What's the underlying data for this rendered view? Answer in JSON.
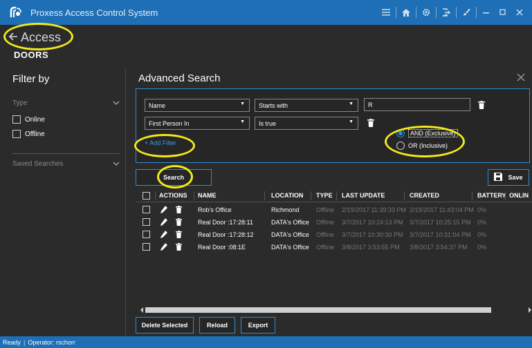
{
  "app": {
    "title": "Proxess Access Control System",
    "accent": "#1e6fb5",
    "highlight": "#f2ea1a"
  },
  "titlebar_icons": [
    "menu-icon",
    "home-icon",
    "gear-icon",
    "logout-icon",
    "brush-icon",
    "minimize-icon",
    "maximize-icon",
    "close-icon"
  ],
  "header": {
    "back_label": "Access",
    "section_label": "DOORS"
  },
  "sidebar": {
    "title": "Filter by",
    "type_label": "Type",
    "options": [
      "Online",
      "Offline"
    ],
    "saved_label": "Saved Searches"
  },
  "advanced": {
    "title": "Advanced Search",
    "filters": [
      {
        "field": "Name",
        "operator": "Starts with",
        "value": "R"
      },
      {
        "field": "First Person In",
        "operator": "Is true",
        "value": ""
      }
    ],
    "add_filter": "+ Add Filter",
    "logic_and": "AND (Exclusive)",
    "logic_or": "OR (Inclusive)",
    "search_label": "Search",
    "save_label": "Save"
  },
  "table": {
    "headers": [
      "ACTIONS",
      "NAME",
      "LOCATION",
      "TYPE",
      "LAST UPDATE",
      "CREATED",
      "BATTERY",
      "ONLIN"
    ],
    "rows": [
      {
        "name": "Rob's Office",
        "location": "Richmond",
        "type": "Offline",
        "last_update": "2/19/2017 11:39:33 PM",
        "created": "2/19/2017 11:43:04 PM",
        "battery": "0%"
      },
      {
        "name": "Real Door :17:28:11",
        "location": "DATA's Office",
        "type": "Offline",
        "last_update": "3/7/2017 10:24:13 PM",
        "created": "3/7/2017 10:25:15 PM",
        "battery": "0%"
      },
      {
        "name": "Real Door :17:28:12",
        "location": "DATA's Office",
        "type": "Offline",
        "last_update": "3/7/2017 10:30:30 PM",
        "created": "3/7/2017 10:31:04 PM",
        "battery": "0%"
      },
      {
        "name": "Real Door :08:1E",
        "location": "DATA's Office",
        "type": "Offline",
        "last_update": "3/8/2017 3:53:55 PM",
        "created": "3/8/2017 3:54:37 PM",
        "battery": "0%"
      }
    ]
  },
  "footer_buttons": {
    "delete": "Delete Selected",
    "reload": "Reload",
    "export": "Export"
  },
  "status": {
    "ready": "Ready",
    "operator": "Operator: rschorr"
  }
}
